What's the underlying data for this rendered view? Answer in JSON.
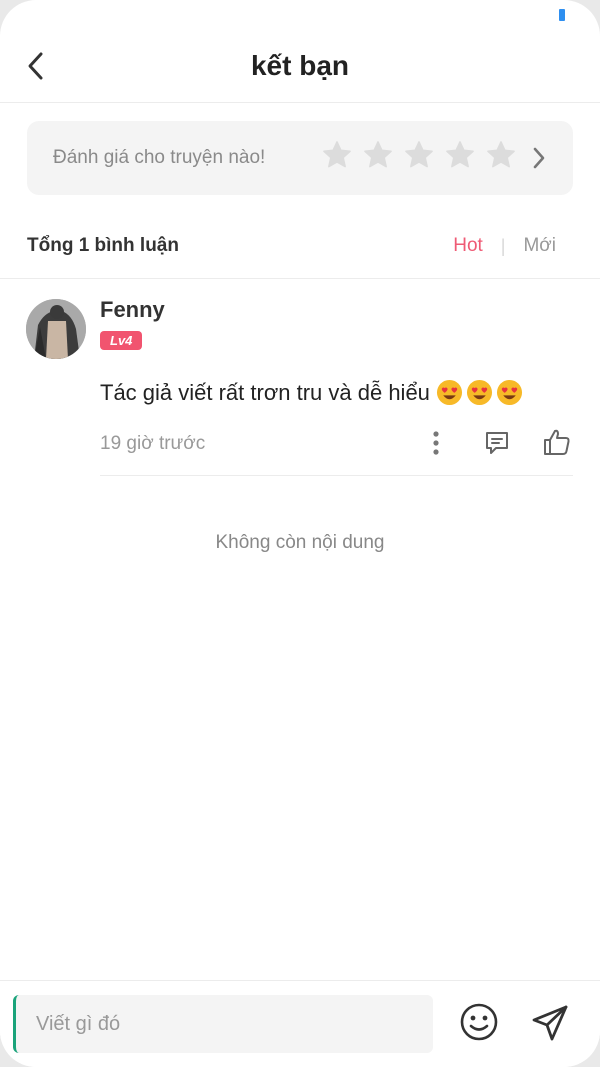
{
  "header": {
    "title": "kết bạn",
    "back_icon": "chevron-left-icon"
  },
  "rating": {
    "prompt": "Đánh giá cho truyện nào!",
    "stars_filled": 0,
    "stars_total": 5,
    "star_color": "#dcdcdc",
    "chevron_icon": "chevron-right-icon"
  },
  "comments_summary": {
    "total": "Tổng 1 bình luận",
    "tabs": [
      {
        "label": "Hot",
        "active": true,
        "color": "#ef5b75"
      },
      {
        "label": "Mới",
        "active": false,
        "color": "#999999"
      }
    ]
  },
  "comments": [
    {
      "username": "Fenny",
      "level": "Lv4",
      "text": "Tác giả viết rất trơn tru và dễ hiểu",
      "emojis": [
        "heart-eyes-emoji",
        "heart-eyes-emoji",
        "heart-eyes-emoji"
      ],
      "time": "19 giờ trước",
      "actions": [
        "more-vertical-icon",
        "reply-icon",
        "thumbs-up-icon"
      ]
    }
  ],
  "end_message": "Không còn nội dung",
  "composer": {
    "placeholder": "Viết gì đó",
    "value": "",
    "emoji_icon": "smile-icon",
    "send_icon": "send-icon"
  },
  "colors": {
    "accent": "#ef5b75",
    "badge": "#f1546f",
    "caret": "#1aa37a",
    "status_indicator": "#2e8ff0"
  }
}
